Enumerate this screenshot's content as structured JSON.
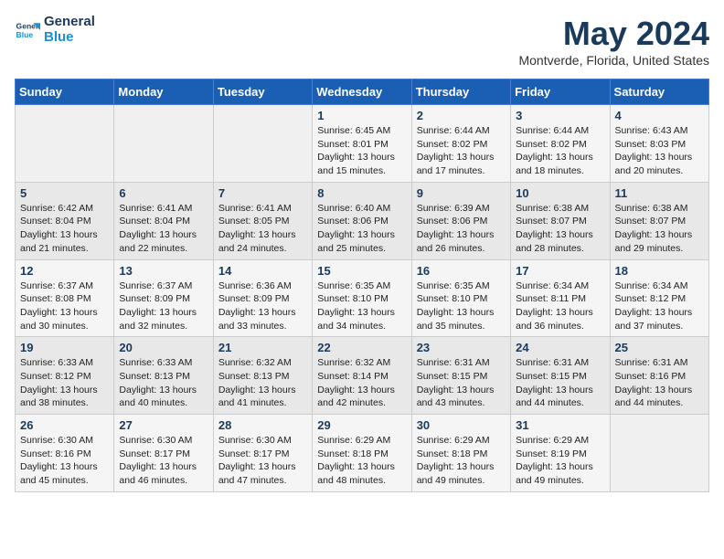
{
  "logo": {
    "line1": "General",
    "line2": "Blue"
  },
  "title": "May 2024",
  "subtitle": "Montverde, Florida, United States",
  "days_of_week": [
    "Sunday",
    "Monday",
    "Tuesday",
    "Wednesday",
    "Thursday",
    "Friday",
    "Saturday"
  ],
  "weeks": [
    [
      {
        "num": "",
        "info": ""
      },
      {
        "num": "",
        "info": ""
      },
      {
        "num": "",
        "info": ""
      },
      {
        "num": "1",
        "info": "Sunrise: 6:45 AM\nSunset: 8:01 PM\nDaylight: 13 hours\nand 15 minutes."
      },
      {
        "num": "2",
        "info": "Sunrise: 6:44 AM\nSunset: 8:02 PM\nDaylight: 13 hours\nand 17 minutes."
      },
      {
        "num": "3",
        "info": "Sunrise: 6:44 AM\nSunset: 8:02 PM\nDaylight: 13 hours\nand 18 minutes."
      },
      {
        "num": "4",
        "info": "Sunrise: 6:43 AM\nSunset: 8:03 PM\nDaylight: 13 hours\nand 20 minutes."
      }
    ],
    [
      {
        "num": "5",
        "info": "Sunrise: 6:42 AM\nSunset: 8:04 PM\nDaylight: 13 hours\nand 21 minutes."
      },
      {
        "num": "6",
        "info": "Sunrise: 6:41 AM\nSunset: 8:04 PM\nDaylight: 13 hours\nand 22 minutes."
      },
      {
        "num": "7",
        "info": "Sunrise: 6:41 AM\nSunset: 8:05 PM\nDaylight: 13 hours\nand 24 minutes."
      },
      {
        "num": "8",
        "info": "Sunrise: 6:40 AM\nSunset: 8:06 PM\nDaylight: 13 hours\nand 25 minutes."
      },
      {
        "num": "9",
        "info": "Sunrise: 6:39 AM\nSunset: 8:06 PM\nDaylight: 13 hours\nand 26 minutes."
      },
      {
        "num": "10",
        "info": "Sunrise: 6:38 AM\nSunset: 8:07 PM\nDaylight: 13 hours\nand 28 minutes."
      },
      {
        "num": "11",
        "info": "Sunrise: 6:38 AM\nSunset: 8:07 PM\nDaylight: 13 hours\nand 29 minutes."
      }
    ],
    [
      {
        "num": "12",
        "info": "Sunrise: 6:37 AM\nSunset: 8:08 PM\nDaylight: 13 hours\nand 30 minutes."
      },
      {
        "num": "13",
        "info": "Sunrise: 6:37 AM\nSunset: 8:09 PM\nDaylight: 13 hours\nand 32 minutes."
      },
      {
        "num": "14",
        "info": "Sunrise: 6:36 AM\nSunset: 8:09 PM\nDaylight: 13 hours\nand 33 minutes."
      },
      {
        "num": "15",
        "info": "Sunrise: 6:35 AM\nSunset: 8:10 PM\nDaylight: 13 hours\nand 34 minutes."
      },
      {
        "num": "16",
        "info": "Sunrise: 6:35 AM\nSunset: 8:10 PM\nDaylight: 13 hours\nand 35 minutes."
      },
      {
        "num": "17",
        "info": "Sunrise: 6:34 AM\nSunset: 8:11 PM\nDaylight: 13 hours\nand 36 minutes."
      },
      {
        "num": "18",
        "info": "Sunrise: 6:34 AM\nSunset: 8:12 PM\nDaylight: 13 hours\nand 37 minutes."
      }
    ],
    [
      {
        "num": "19",
        "info": "Sunrise: 6:33 AM\nSunset: 8:12 PM\nDaylight: 13 hours\nand 38 minutes."
      },
      {
        "num": "20",
        "info": "Sunrise: 6:33 AM\nSunset: 8:13 PM\nDaylight: 13 hours\nand 40 minutes."
      },
      {
        "num": "21",
        "info": "Sunrise: 6:32 AM\nSunset: 8:13 PM\nDaylight: 13 hours\nand 41 minutes."
      },
      {
        "num": "22",
        "info": "Sunrise: 6:32 AM\nSunset: 8:14 PM\nDaylight: 13 hours\nand 42 minutes."
      },
      {
        "num": "23",
        "info": "Sunrise: 6:31 AM\nSunset: 8:15 PM\nDaylight: 13 hours\nand 43 minutes."
      },
      {
        "num": "24",
        "info": "Sunrise: 6:31 AM\nSunset: 8:15 PM\nDaylight: 13 hours\nand 44 minutes."
      },
      {
        "num": "25",
        "info": "Sunrise: 6:31 AM\nSunset: 8:16 PM\nDaylight: 13 hours\nand 44 minutes."
      }
    ],
    [
      {
        "num": "26",
        "info": "Sunrise: 6:30 AM\nSunset: 8:16 PM\nDaylight: 13 hours\nand 45 minutes."
      },
      {
        "num": "27",
        "info": "Sunrise: 6:30 AM\nSunset: 8:17 PM\nDaylight: 13 hours\nand 46 minutes."
      },
      {
        "num": "28",
        "info": "Sunrise: 6:30 AM\nSunset: 8:17 PM\nDaylight: 13 hours\nand 47 minutes."
      },
      {
        "num": "29",
        "info": "Sunrise: 6:29 AM\nSunset: 8:18 PM\nDaylight: 13 hours\nand 48 minutes."
      },
      {
        "num": "30",
        "info": "Sunrise: 6:29 AM\nSunset: 8:18 PM\nDaylight: 13 hours\nand 49 minutes."
      },
      {
        "num": "31",
        "info": "Sunrise: 6:29 AM\nSunset: 8:19 PM\nDaylight: 13 hours\nand 49 minutes."
      },
      {
        "num": "",
        "info": ""
      }
    ]
  ]
}
